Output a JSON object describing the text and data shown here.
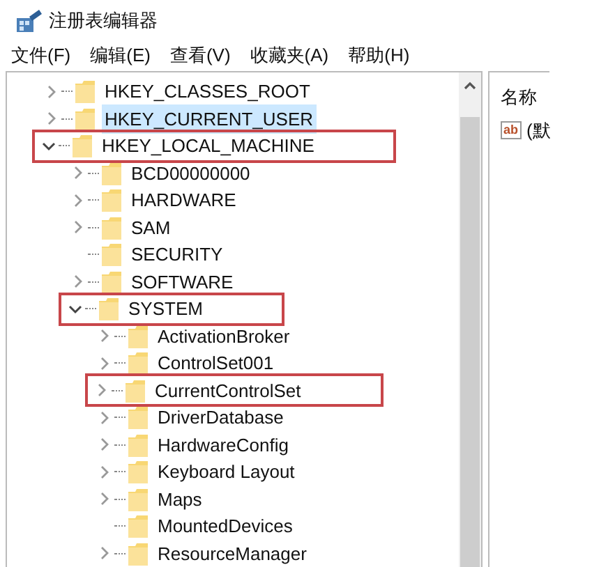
{
  "window": {
    "title": "注册表编辑器"
  },
  "menu": [
    "文件(F)",
    "编辑(E)",
    "查看(V)",
    "收藏夹(A)",
    "帮助(H)"
  ],
  "tree": [
    {
      "label": "HKEY_CLASSES_ROOT",
      "has_children": true,
      "expanded": false,
      "selected": false,
      "highlighted": false
    },
    {
      "label": "HKEY_CURRENT_USER",
      "has_children": true,
      "expanded": false,
      "selected": true,
      "highlighted": false
    },
    {
      "label": "HKEY_LOCAL_MACHINE",
      "has_children": true,
      "expanded": true,
      "selected": false,
      "highlighted": true,
      "children": [
        {
          "label": "BCD00000000",
          "has_children": true,
          "expanded": false,
          "selected": false,
          "highlighted": false
        },
        {
          "label": "HARDWARE",
          "has_children": true,
          "expanded": false,
          "selected": false,
          "highlighted": false
        },
        {
          "label": "SAM",
          "has_children": true,
          "expanded": false,
          "selected": false,
          "highlighted": false
        },
        {
          "label": "SECURITY",
          "has_children": false,
          "selected": false,
          "highlighted": false
        },
        {
          "label": "SOFTWARE",
          "has_children": true,
          "expanded": false,
          "selected": false,
          "highlighted": false
        },
        {
          "label": "SYSTEM",
          "has_children": true,
          "expanded": true,
          "selected": false,
          "highlighted": true,
          "children": [
            {
              "label": "ActivationBroker",
              "has_children": true,
              "expanded": false,
              "selected": false,
              "highlighted": false
            },
            {
              "label": "ControlSet001",
              "has_children": true,
              "expanded": false,
              "selected": false,
              "highlighted": false
            },
            {
              "label": "CurrentControlSet",
              "has_children": true,
              "expanded": false,
              "selected": false,
              "highlighted": true
            },
            {
              "label": "DriverDatabase",
              "has_children": true,
              "expanded": false,
              "selected": false,
              "highlighted": false
            },
            {
              "label": "HardwareConfig",
              "has_children": true,
              "expanded": false,
              "selected": false,
              "highlighted": false
            },
            {
              "label": "Keyboard Layout",
              "has_children": true,
              "expanded": false,
              "selected": false,
              "highlighted": false
            },
            {
              "label": "Maps",
              "has_children": true,
              "expanded": false,
              "selected": false,
              "highlighted": false
            },
            {
              "label": "MountedDevices",
              "has_children": false,
              "selected": false,
              "highlighted": false
            },
            {
              "label": "ResourceManager",
              "has_children": true,
              "expanded": false,
              "selected": false,
              "highlighted": false
            }
          ]
        }
      ]
    }
  ],
  "values_pane": {
    "column_header": "名称",
    "rows": [
      {
        "icon_text": "ab",
        "name": "(默"
      }
    ]
  }
}
